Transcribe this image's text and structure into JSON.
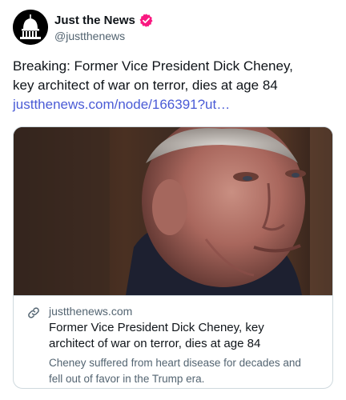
{
  "author": {
    "display_name": "Just the News",
    "handle": "@justthenews",
    "verified": true,
    "verified_color": "#f91880"
  },
  "post": {
    "text_line1": "Breaking: Former Vice President Dick Cheney,",
    "text_line2": "key architect of war on terror, dies at age 84",
    "link_text": "justthenews.com/node/166391?ut…"
  },
  "card": {
    "domain": "justthenews.com",
    "title_line1": "Former Vice President Dick Cheney, key",
    "title_line2": "architect of war on terror, dies at age 84",
    "description_line1": "Cheney suffered from heart disease for decades and",
    "description_line2": "fell out of favor in the Trump era.",
    "image_icon": "portrait-photo"
  },
  "colors": {
    "text": "#0f1419",
    "secondary": "#536471",
    "link": "#4a5bd6",
    "border": "#cfd9de"
  }
}
